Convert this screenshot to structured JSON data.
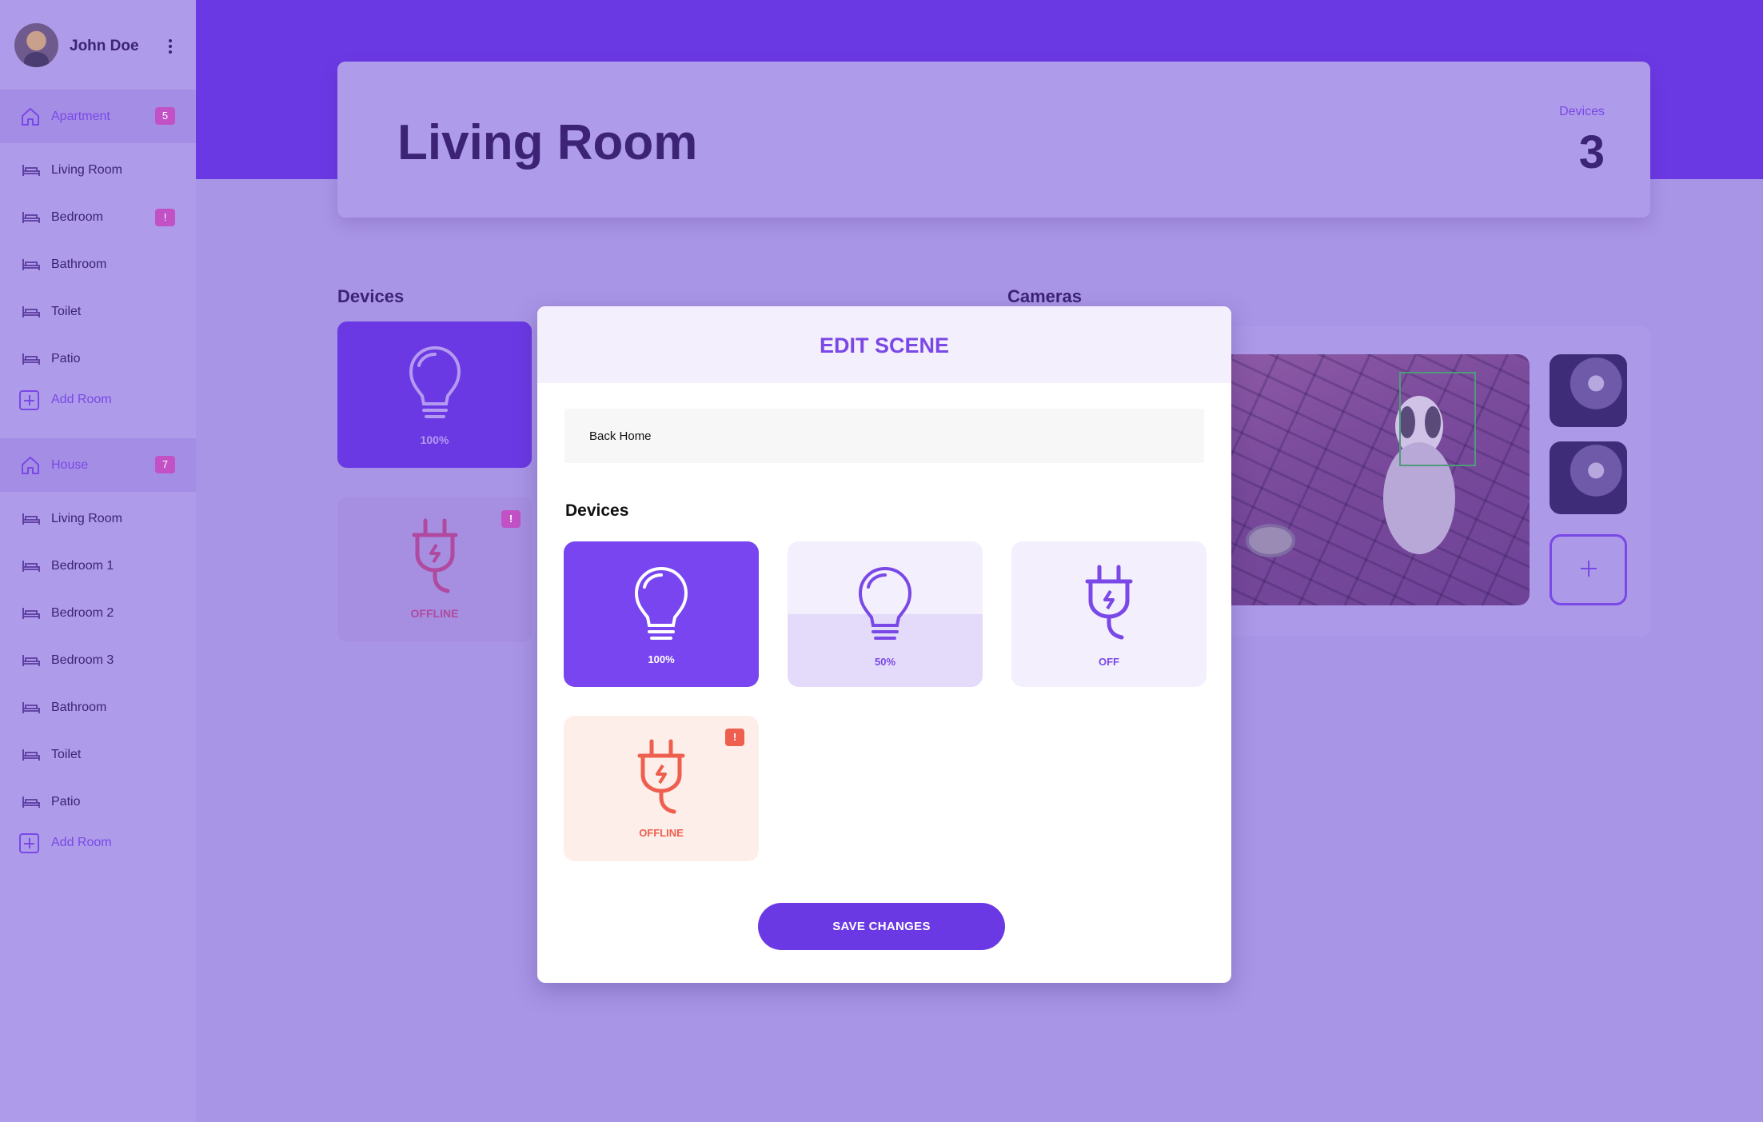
{
  "user": {
    "name": "John Doe"
  },
  "sidebar": {
    "groups": [
      {
        "label": "Apartment",
        "badge": "5",
        "rooms": [
          {
            "label": "Living Room",
            "badge": ""
          },
          {
            "label": "Bedroom",
            "badge": "!"
          },
          {
            "label": "Bathroom",
            "badge": ""
          },
          {
            "label": "Toilet",
            "badge": ""
          },
          {
            "label": "Patio",
            "badge": ""
          }
        ],
        "add_label": "Add Room"
      },
      {
        "label": "House",
        "badge": "7",
        "rooms": [
          {
            "label": "Living Room"
          },
          {
            "label": "Bedroom 1"
          },
          {
            "label": "Bedroom 2"
          },
          {
            "label": "Bedroom 3"
          },
          {
            "label": "Bathroom"
          },
          {
            "label": "Toilet"
          },
          {
            "label": "Patio"
          }
        ],
        "add_label": "Add Room"
      }
    ]
  },
  "header": {
    "title": "Living Room",
    "devices_label": "Devices",
    "devices_count": "3"
  },
  "main": {
    "devices_title": "Devices",
    "cameras_title": "Cameras",
    "devices": [
      {
        "icon": "lightbulb-icon",
        "status": "100%"
      },
      {
        "icon": "plug-icon",
        "status": "OFFLINE",
        "alert": "!"
      }
    ]
  },
  "modal": {
    "title": "EDIT SCENE",
    "scene_name": "Back Home",
    "devices_title": "Devices",
    "devices": [
      {
        "icon": "lightbulb-icon",
        "status": "100%",
        "level": 1.0
      },
      {
        "icon": "lightbulb-icon",
        "status": "50%",
        "level": 0.5
      },
      {
        "icon": "plug-icon",
        "status": "OFF"
      },
      {
        "icon": "plug-icon",
        "status": "OFFLINE",
        "alert": "!"
      }
    ],
    "save_label": "SAVE CHANGES"
  },
  "colors": {
    "accent": "#6b39e3",
    "accent_active": "#7845f0",
    "dark_text": "#3c2375",
    "alert": "#ee5f4f",
    "badge": "#c151c5"
  }
}
